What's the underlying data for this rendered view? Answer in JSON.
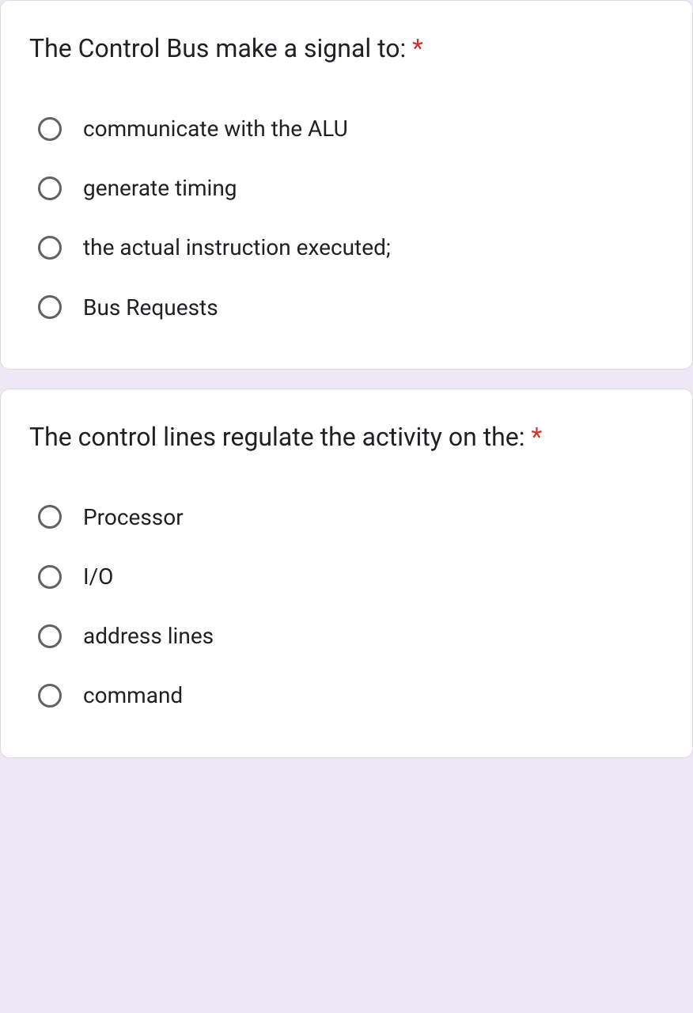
{
  "questions": [
    {
      "title": "The Control Bus make a signal to:",
      "required": "*",
      "options": [
        "communicate with the ALU",
        "generate timing",
        "the actual instruction executed;",
        "Bus Requests"
      ]
    },
    {
      "title": "The control lines regulate the activity on the:",
      "required": "*",
      "options": [
        "Processor",
        "I/O",
        "address lines",
        "command"
      ]
    }
  ],
  "colors": {
    "required": "#d93025",
    "radio_border": "#5f6368",
    "text": "#202124",
    "background": "#ede7f6"
  }
}
